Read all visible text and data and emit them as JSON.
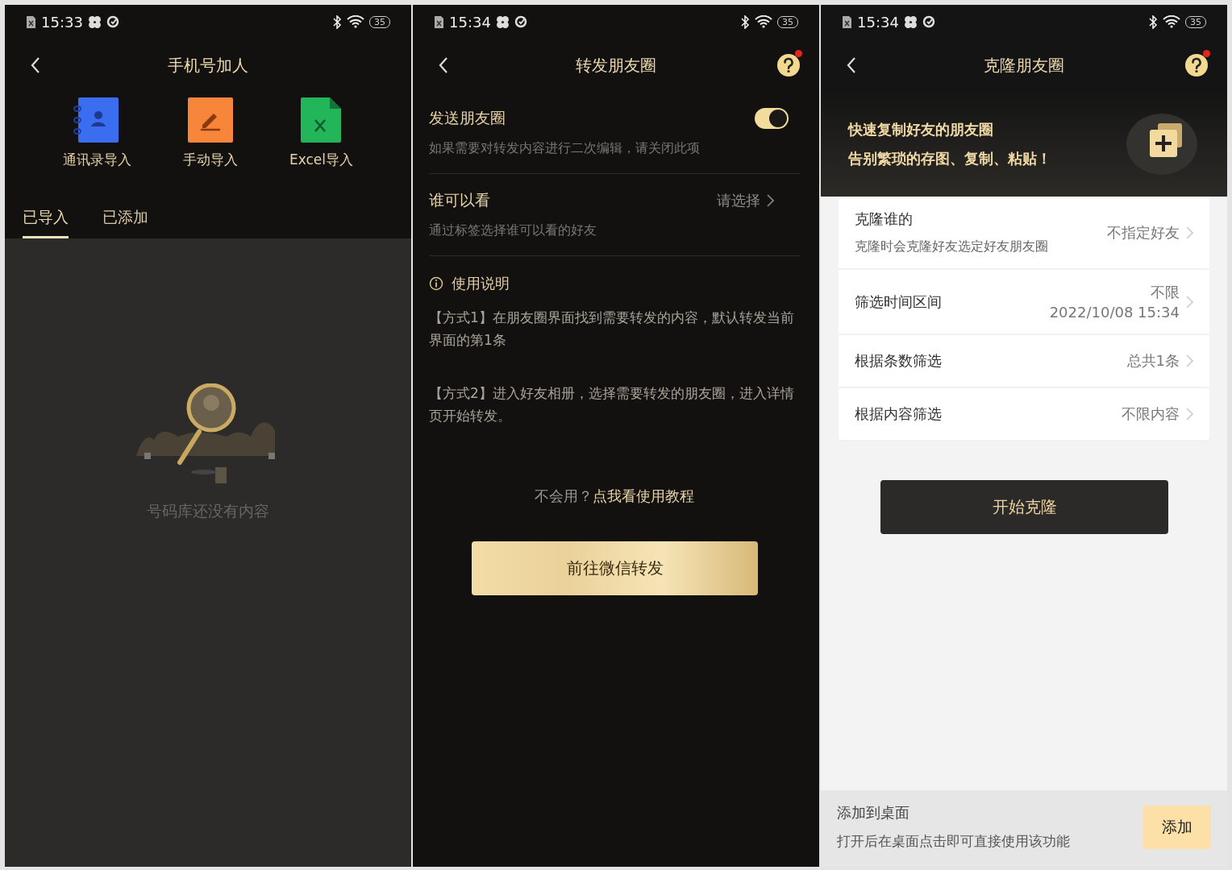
{
  "screens": [
    {
      "status_bar": {
        "time": "15:33",
        "battery": "35"
      },
      "title": "手机号加人",
      "import_options": [
        {
          "kind": "contacts",
          "label": "通讯录导入"
        },
        {
          "kind": "manual",
          "label": "手动导入"
        },
        {
          "kind": "excel",
          "label": "Excel导入"
        }
      ],
      "tabs": [
        {
          "label": "已导入",
          "selected": true
        },
        {
          "label": "已添加",
          "selected": false
        }
      ],
      "empty_text": "号码库还没有内容"
    },
    {
      "status_bar": {
        "time": "15:34",
        "battery": "35"
      },
      "title": "转发朋友圈",
      "help_notice": true,
      "send_row": {
        "label": "发送朋友圈",
        "description": "如果需要对转发内容进行二次编辑，请关闭此项",
        "on": true
      },
      "visibility_row": {
        "label": "谁可以看",
        "value": "请选择",
        "description": "通过标签选择谁可以看的好友"
      },
      "usage": {
        "heading": "使用说明",
        "paragraphs": [
          "【方式1】在朋友圈界面找到需要转发的内容，默认转发当前界面的第1条",
          "【方式2】进入好友相册，选择需要转发的朋友圈，进入详情页开始转发。"
        ]
      },
      "tutorial": {
        "prompt": "不会用？",
        "link": "点我看使用教程"
      },
      "button": "前往微信转发"
    },
    {
      "status_bar": {
        "time": "15:34",
        "battery": "35"
      },
      "title": "克隆朋友圈",
      "help_notice": true,
      "banner": [
        "快速复制好友的朋友圈",
        "告别繁琐的存图、复制、粘贴！"
      ],
      "rows": [
        {
          "label": "克隆谁的",
          "values": [
            "不指定好友"
          ],
          "description": "克隆时会克隆好友选定好友朋友圈"
        },
        {
          "label": "筛选时间区间",
          "values": [
            "不限",
            "2022/10/08 15:34"
          ]
        },
        {
          "label": "根据条数筛选",
          "values": [
            "总共1条"
          ]
        },
        {
          "label": "根据内容筛选",
          "values": [
            "不限内容"
          ]
        }
      ],
      "button": "开始克隆",
      "shortcut": {
        "title": "添加到桌面",
        "description": "打开后在桌面点击即可直接使用该功能",
        "button": "添加"
      }
    }
  ]
}
